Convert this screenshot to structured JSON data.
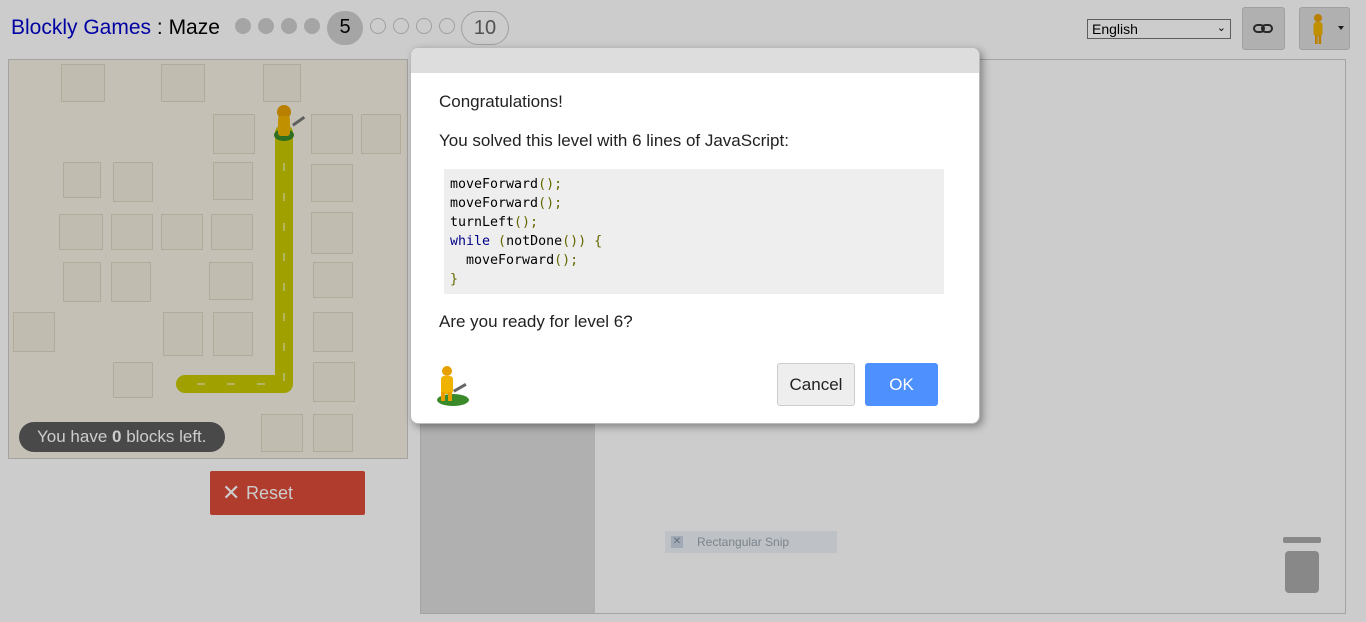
{
  "header": {
    "app_title": "Blockly Games",
    "separator": " : ",
    "game_title": "Maze",
    "levels": {
      "current": "5",
      "last": "10",
      "completed_before_current": 4,
      "pending_after_current": 4
    },
    "language": {
      "selected": "English"
    },
    "link_icon": "link-icon",
    "pegman_menu_icon": "pegman-icon"
  },
  "maze": {
    "blocks_left_prefix": "You have ",
    "blocks_left_count": "0",
    "blocks_left_suffix": " blocks left."
  },
  "controls": {
    "reset_label": "Reset",
    "reset_icon": "close-icon"
  },
  "workspace": {
    "snip_label": "Rectangular Snip",
    "trash_icon": "trash-icon"
  },
  "dialog": {
    "heading": "Congratulations!",
    "message": "You solved this level with 6 lines of JavaScript:",
    "code": [
      "moveForward();",
      "moveForward();",
      "turnLeft();",
      "while (notDone()) {",
      "  moveForward();",
      "}"
    ],
    "question": "Are you ready for level 6?",
    "cancel_label": "Cancel",
    "ok_label": "OK",
    "accent_color": "#4d90fe"
  }
}
